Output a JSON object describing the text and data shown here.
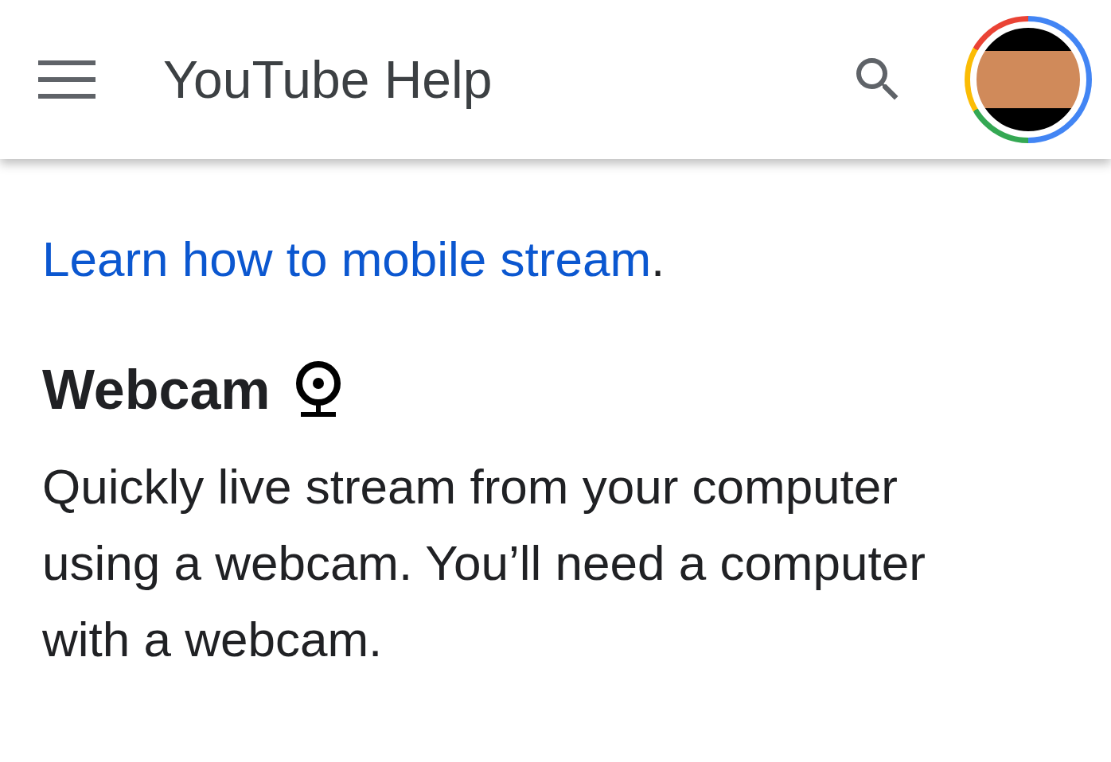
{
  "header": {
    "title": "YouTube Help"
  },
  "link_line": {
    "link": "Learn how to mobile stream",
    "after": "."
  },
  "section": {
    "heading": "Webcam",
    "body": "Quickly live stream from your computer using a webcam. You’ll need a computer with a webcam."
  }
}
